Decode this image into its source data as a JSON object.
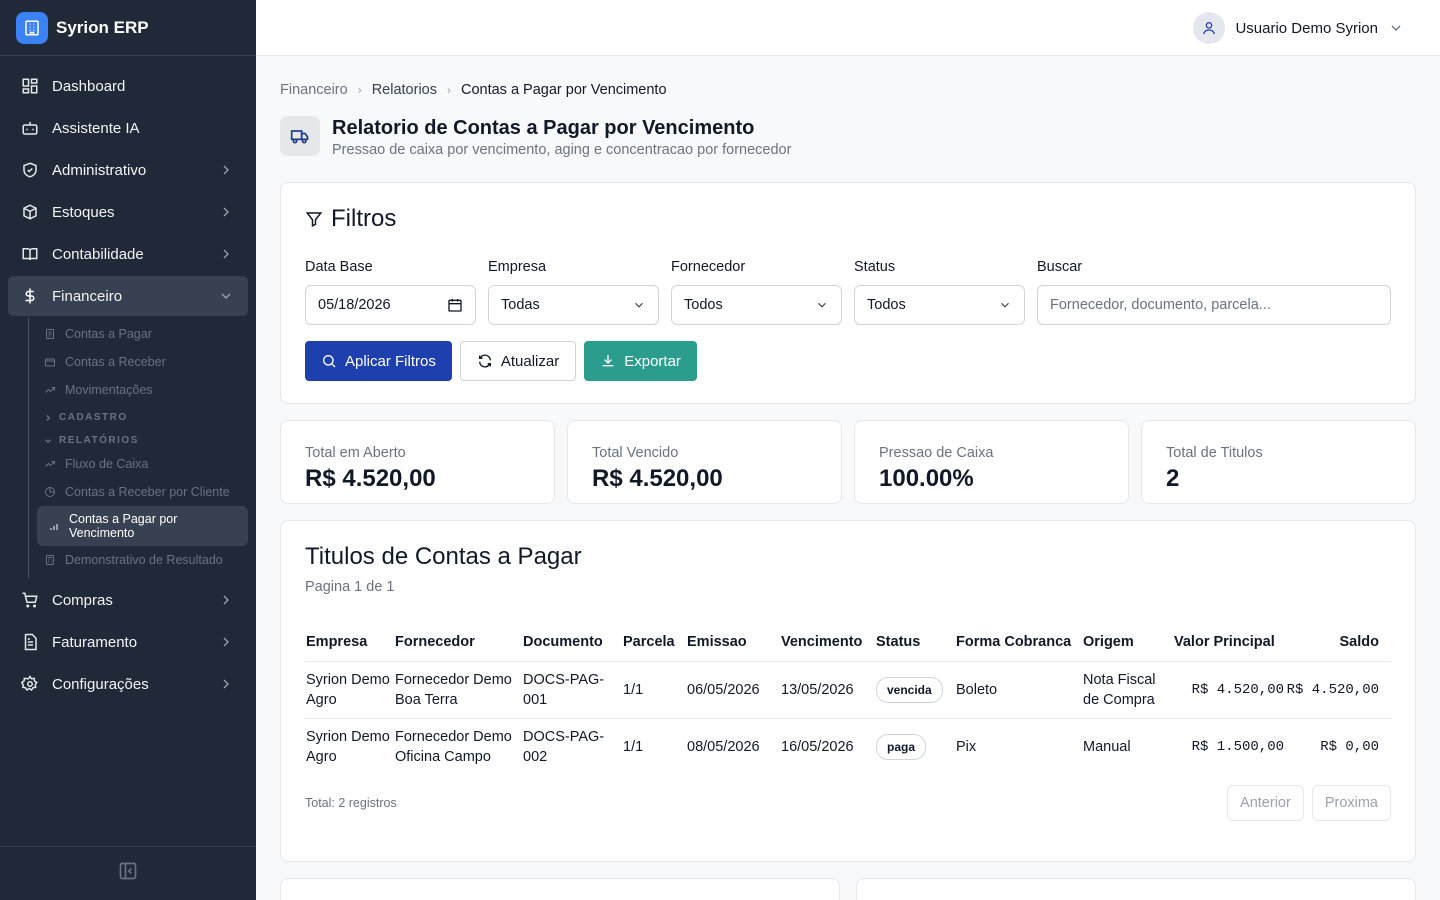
{
  "app": {
    "name": "Syrion ERP"
  },
  "user": {
    "name": "Usuario Demo Syrion"
  },
  "sidebar": {
    "items": [
      {
        "label": "Dashboard"
      },
      {
        "label": "Assistente IA"
      },
      {
        "label": "Administrativo"
      },
      {
        "label": "Estoques"
      },
      {
        "label": "Contabilidade"
      },
      {
        "label": "Financeiro"
      },
      {
        "label": "Compras"
      },
      {
        "label": "Faturamento"
      },
      {
        "label": "Configurações"
      }
    ],
    "sub": {
      "contas_pagar": "Contas a Pagar",
      "contas_receber": "Contas a Receber",
      "movimentacoes": "Movimentações",
      "cadastro": "CADASTRO",
      "relatorios": "RELATÓRIOS",
      "fluxo": "Fluxo de Caixa",
      "receber_cliente": "Contas a Receber por Cliente",
      "pagar_venc": "Contas a Pagar por Vencimento",
      "demonstrativo": "Demonstrativo de Resultado"
    }
  },
  "breadcrumb": {
    "l1": "Financeiro",
    "l2": "Relatorios",
    "l3": "Contas a Pagar por Vencimento"
  },
  "page": {
    "title": "Relatorio de Contas a Pagar por Vencimento",
    "subtitle": "Pressao de caixa por vencimento, aging e concentracao por fornecedor"
  },
  "filters": {
    "title": "Filtros",
    "data_base_label": "Data Base",
    "data_base_value": "05/18/2026",
    "empresa_label": "Empresa",
    "empresa_value": "Todas",
    "fornecedor_label": "Fornecedor",
    "fornecedor_value": "Todos",
    "status_label": "Status",
    "status_value": "Todos",
    "buscar_label": "Buscar",
    "buscar_placeholder": "Fornecedor, documento, parcela...",
    "apply": "Aplicar Filtros",
    "refresh": "Atualizar",
    "export": "Exportar"
  },
  "kpis": [
    {
      "label": "Total em Aberto",
      "value": "R$ 4.520,00"
    },
    {
      "label": "Total Vencido",
      "value": "R$ 4.520,00"
    },
    {
      "label": "Pressao de Caixa",
      "value": "100.00%"
    },
    {
      "label": "Total de Titulos",
      "value": "2"
    }
  ],
  "table": {
    "title": "Titulos de Contas a Pagar",
    "page_info": "Pagina 1 de 1",
    "headers": [
      "Empresa",
      "Fornecedor",
      "Documento",
      "Parcela",
      "Emissao",
      "Vencimento",
      "Status",
      "Forma Cobranca",
      "Origem",
      "Valor Principal",
      "Saldo"
    ],
    "rows": [
      [
        "Syrion Demo Agro",
        "Fornecedor Demo Boa Terra",
        "DOCS-PAG-001",
        "1/1",
        "06/05/2026",
        "13/05/2026",
        "vencida",
        "Boleto",
        "Nota Fiscal de Compra",
        "R$ 4.520,00",
        "R$ 4.520,00"
      ],
      [
        "Syrion Demo Agro",
        "Fornecedor Demo Oficina Campo",
        "DOCS-PAG-002",
        "1/1",
        "08/05/2026",
        "16/05/2026",
        "paga",
        "Pix",
        "Manual",
        "R$ 1.500,00",
        "R$ 0,00"
      ]
    ],
    "total": "Total: 2 registros",
    "prev": "Anterior",
    "next": "Proxima"
  },
  "colors": {
    "sidebar": "#1f2937",
    "primary": "#1e40af",
    "export": "#2a9d8f",
    "brand": "#3b82f6"
  }
}
